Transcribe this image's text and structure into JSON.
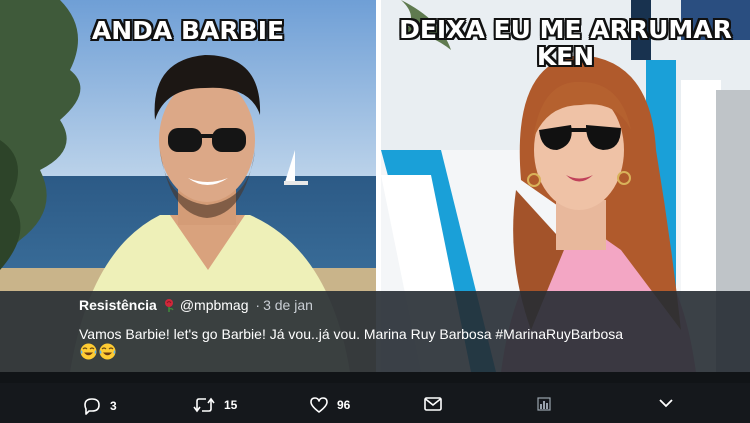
{
  "meme": {
    "left_caption": "ANDA BARBIE",
    "right_caption": "DEIXA EU ME ARRUMAR\nKEN"
  },
  "tweet": {
    "author_name": "Resistência",
    "author_emoji": "rose-icon",
    "handle": "@mpbmag",
    "separator": "·",
    "timestamp": "3 de jan",
    "text": "Vamos Barbie! let's go Barbie!  Já vou..já vou. Marina Ruy Barbosa #MarinaRuyBarbosa",
    "emojis": [
      "face-with-tears-of-joy-icon",
      "face-with-tears-of-joy-icon"
    ]
  },
  "actions": {
    "reply_count": "3",
    "retweet_count": "15",
    "like_count": "96"
  },
  "colors": {
    "overlay": "#262c33",
    "action_bar": "#15181c",
    "text": "#ffffff",
    "muted": "#c9ced4"
  }
}
